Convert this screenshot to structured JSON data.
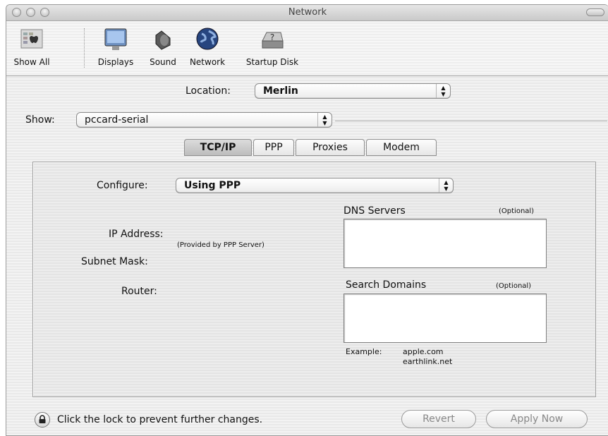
{
  "window": {
    "title": "Network"
  },
  "toolbar": {
    "items": [
      {
        "label": "Show All",
        "icon": "apple-show-all-icon"
      },
      {
        "label": "Displays",
        "icon": "display-icon"
      },
      {
        "label": "Sound",
        "icon": "speaker-icon"
      },
      {
        "label": "Network",
        "icon": "globe-icon"
      },
      {
        "label": "Startup Disk",
        "icon": "disk-icon"
      }
    ]
  },
  "location": {
    "label": "Location:",
    "value": "Merlin"
  },
  "show": {
    "label": "Show:",
    "value": "pccard-serial"
  },
  "tabs": [
    {
      "label": "TCP/IP",
      "active": true
    },
    {
      "label": "PPP",
      "active": false
    },
    {
      "label": "Proxies",
      "active": false
    },
    {
      "label": "Modem",
      "active": false
    }
  ],
  "tcpip": {
    "configure_label": "Configure:",
    "configure_value": "Using PPP",
    "ip_address_label": "IP Address:",
    "provided_note": "(Provided by PPP Server)",
    "subnet_mask_label": "Subnet Mask:",
    "router_label": "Router:",
    "dns_servers_label": "DNS Servers",
    "dns_optional": "(Optional)",
    "dns_servers_value": "",
    "search_domains_label": "Search Domains",
    "search_optional": "(Optional)",
    "search_domains_value": "",
    "example_label": "Example:",
    "example_line1": "apple.com",
    "example_line2": "earthlink.net"
  },
  "footer": {
    "lock_text": "Click the lock to prevent further changes.",
    "revert_label": "Revert",
    "apply_label": "Apply Now"
  }
}
